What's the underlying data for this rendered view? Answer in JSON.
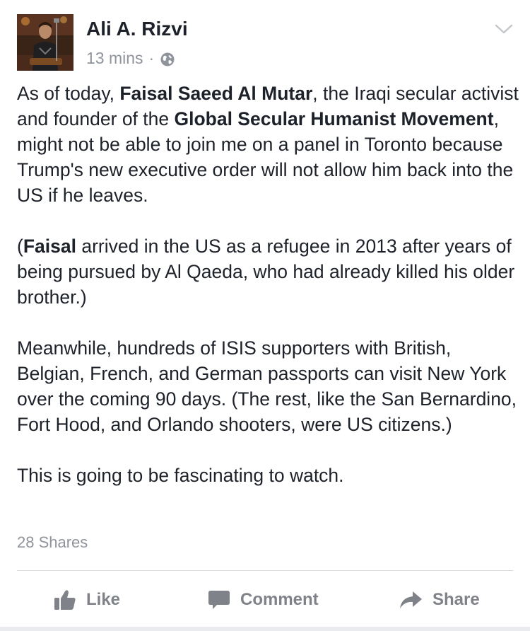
{
  "post": {
    "author": "Ali A. Rizvi",
    "time": "13 mins",
    "separator": "·",
    "privacy_icon": "globe-icon",
    "menu_icon": "chevron-down-icon",
    "paragraphs": [
      [
        {
          "text": "As of today, ",
          "bold": false
        },
        {
          "text": "Faisal Saeed Al Mutar",
          "bold": true
        },
        {
          "text": ", the Iraqi secular activist and founder of the ",
          "bold": false
        },
        {
          "text": "Global Secular Humanist Movement",
          "bold": true
        },
        {
          "text": ", might not be able to join me on a panel in Toronto because Trump's new executive order will not allow him back into the US if he leaves.",
          "bold": false
        }
      ],
      [
        {
          "text": "(",
          "bold": false
        },
        {
          "text": "Faisal",
          "bold": true
        },
        {
          "text": " arrived in the US as a refugee in 2013 after years of being pursued by Al Qaeda, who had already killed his older brother.)",
          "bold": false
        }
      ],
      [
        {
          "text": "Meanwhile, hundreds of ISIS supporters with British, Belgian, French, and German passports can visit New York over the coming 90 days. (The rest, like the San Bernardino, Fort Hood, and Orlando shooters, were US citizens.)",
          "bold": false
        }
      ],
      [
        {
          "text": "This is going to be fascinating to watch.",
          "bold": false
        }
      ]
    ],
    "shares": "28 Shares"
  },
  "actions": {
    "like_label": "Like",
    "comment_label": "Comment",
    "share_label": "Share"
  },
  "colors": {
    "text": "#1d2129",
    "secondary": "#90949c",
    "action": "#7f8389",
    "divider": "#dadde1"
  }
}
